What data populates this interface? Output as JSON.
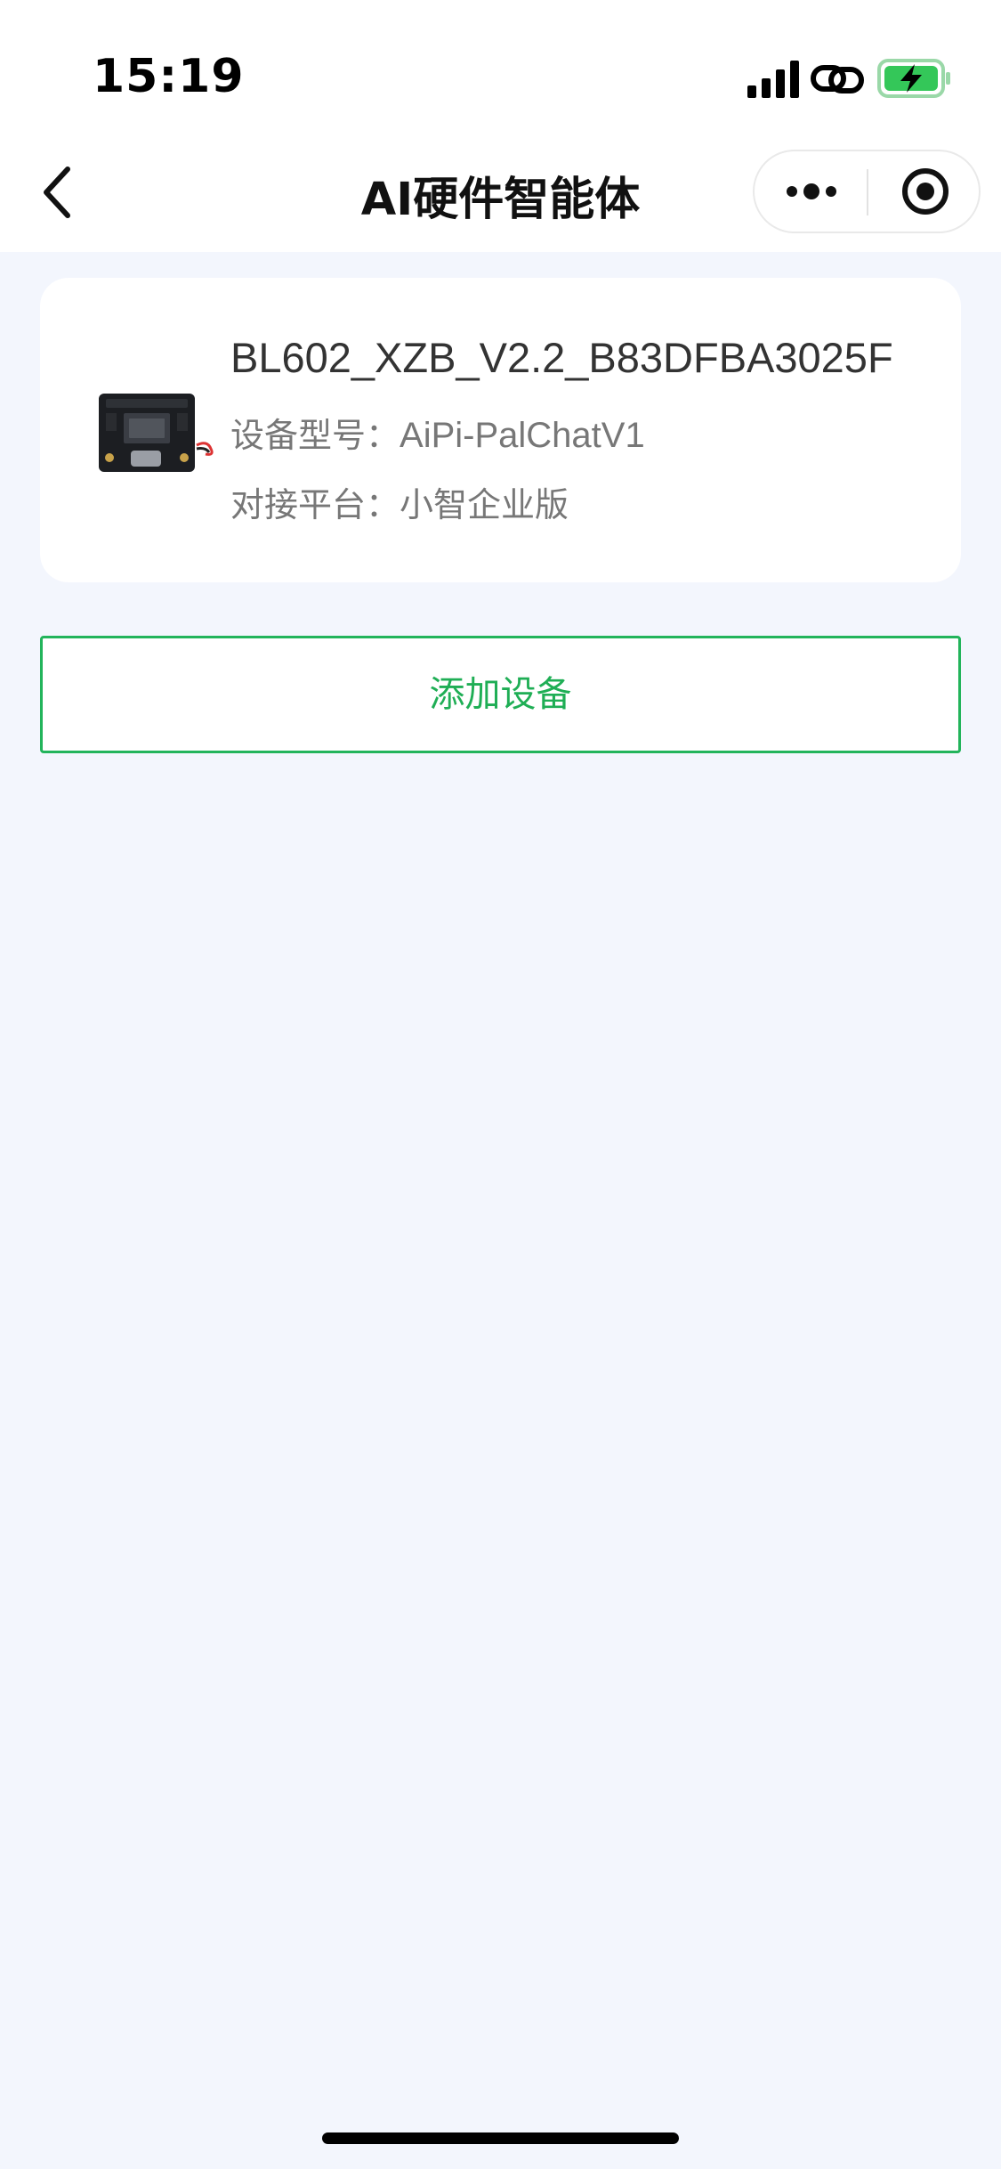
{
  "status_bar": {
    "time": "15:19",
    "icons": [
      "signal-icon",
      "link-icon",
      "battery-charging-icon"
    ]
  },
  "nav": {
    "title": "AI硬件智能体",
    "back_icon": "chevron-left-icon",
    "more_icon": "more-dots-icon",
    "close_icon": "target-close-icon"
  },
  "device": {
    "name": "BL602_XZB_V2.2_B83DFBA3025F",
    "model_label": "设备型号：",
    "model_value": "AiPi-PalChatV1",
    "platform_label": "对接平台：",
    "platform_value": "小智企业版",
    "image_icon": "dev-board-image"
  },
  "actions": {
    "add_device_label": "添加设备"
  },
  "colors": {
    "page_background": "#F3F6FD",
    "accent_green": "#1FAE55",
    "battery_green": "#34C759"
  }
}
